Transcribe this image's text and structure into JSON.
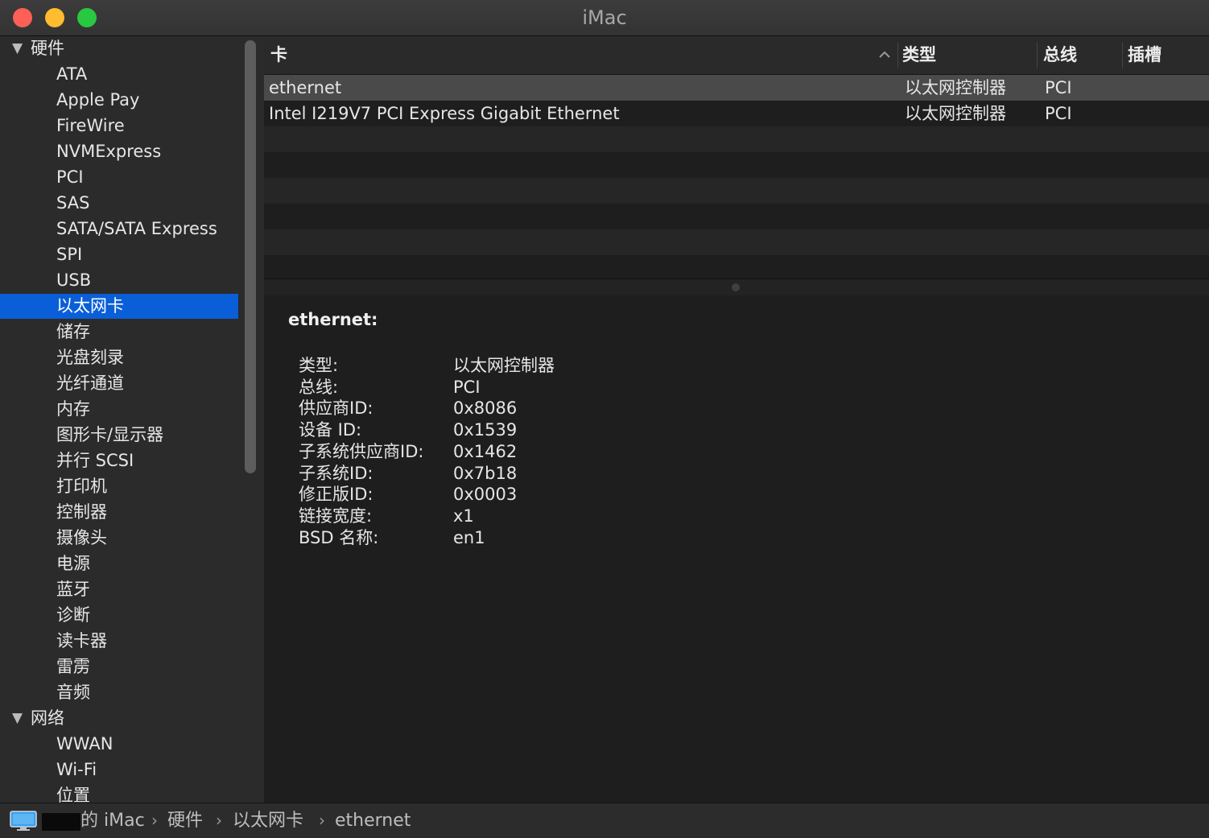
{
  "window": {
    "title": "iMac"
  },
  "sidebar": {
    "sections": [
      {
        "label": "硬件",
        "items": [
          "ATA",
          "Apple Pay",
          "FireWire",
          "NVMExpress",
          "PCI",
          "SAS",
          "SATA/SATA Express",
          "SPI",
          "USB",
          "以太网卡",
          "储存",
          "光盘刻录",
          "光纤通道",
          "内存",
          "图形卡/显示器",
          "并行 SCSI",
          "打印机",
          "控制器",
          "摄像头",
          "电源",
          "蓝牙",
          "诊断",
          "读卡器",
          "雷雳",
          "音频"
        ]
      },
      {
        "label": "网络",
        "items": [
          "WWAN",
          "Wi-Fi",
          "位置"
        ]
      }
    ],
    "selected": "以太网卡"
  },
  "table": {
    "columns": [
      "卡",
      "类型",
      "总线",
      "插槽"
    ],
    "rows": [
      {
        "card": "ethernet",
        "type": "以太网控制器",
        "bus": "PCI",
        "slot": ""
      },
      {
        "card": "Intel I219V7 PCI Express Gigabit Ethernet",
        "type": "以太网控制器",
        "bus": "PCI",
        "slot": ""
      }
    ]
  },
  "detail": {
    "title": "ethernet:",
    "fields": [
      {
        "key": "类型:",
        "value": "以太网控制器"
      },
      {
        "key": "总线:",
        "value": "PCI"
      },
      {
        "key": "供应商ID:",
        "value": "0x8086"
      },
      {
        "key": "设备 ID:",
        "value": "0x1539"
      },
      {
        "key": "子系统供应商ID:",
        "value": "0x1462"
      },
      {
        "key": "子系统ID:",
        "value": "0x7b18"
      },
      {
        "key": "修正版ID:",
        "value": "0x0003"
      },
      {
        "key": "链接宽度:",
        "value": "x1"
      },
      {
        "key": "BSD 名称:",
        "value": "en1"
      }
    ]
  },
  "pathbar": {
    "items": [
      "的 iMac",
      "硬件",
      "以太网卡",
      "ethernet"
    ],
    "separator": "›"
  },
  "colors": {
    "selection": "#0a5fd8",
    "close": "#fe5f57",
    "minimize": "#febc2e",
    "maximize": "#28c840"
  }
}
